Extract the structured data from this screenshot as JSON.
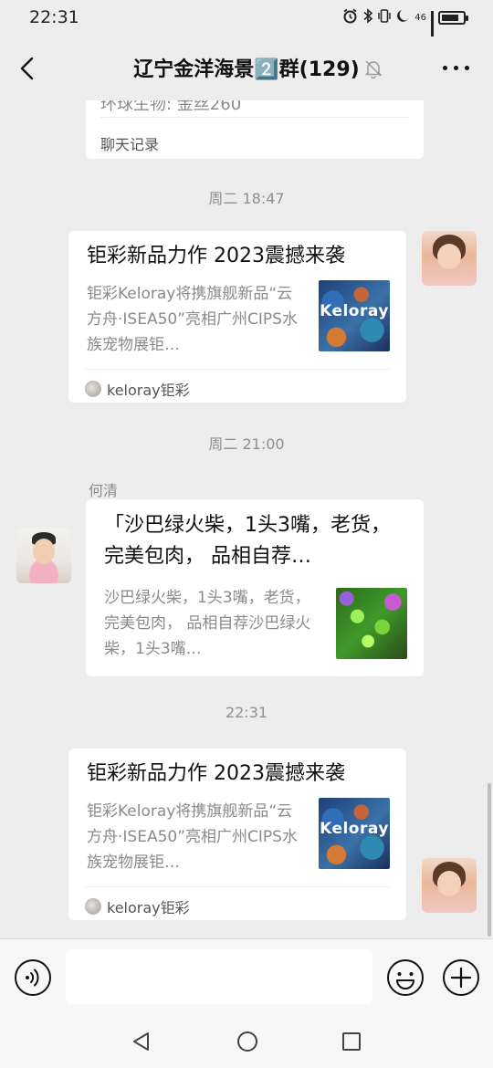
{
  "status_bar": {
    "time": "22:31",
    "network": "46"
  },
  "header": {
    "title": "辽宁金洋海景2️⃣群(129)"
  },
  "top_card": {
    "snippet": "环球生物: 金丝260",
    "tag": "聊天记录"
  },
  "messages": [
    {
      "timestamp": "周二 18:47",
      "title": "钜彩新品力作 2023震撼来袭",
      "desc": "钜彩Keloray将携旗舰新品“云方舟·ISEA50”亮相广州CIPS水族宠物展钜…",
      "thumb_text": "Keloray",
      "source": "keloray钜彩"
    },
    {
      "timestamp": "周二 21:00",
      "sender": "何清",
      "title": "「沙巴绿火柴，1头3嘴，老货，完美包肉， 品相自荐…",
      "desc": "沙巴绿火柴，1头3嘴，老货，完美包肉， 品相自荐沙巴绿火柴，1头3嘴…"
    },
    {
      "timestamp": "22:31",
      "title": "钜彩新品力作 2023震撼来袭",
      "desc": "钜彩Keloray将携旗舰新品“云方舟·ISEA50”亮相广州CIPS水族宠物展钜…",
      "thumb_text": "Keloray",
      "source": "keloray钜彩"
    }
  ],
  "input": {
    "value": ""
  },
  "icons": {
    "back": "chevron-left-icon",
    "mute": "bell-off-icon",
    "more": "more-horizontal-icon",
    "voice": "voice-icon",
    "emoji": "emoji-icon",
    "plus": "plus-circle-icon"
  }
}
